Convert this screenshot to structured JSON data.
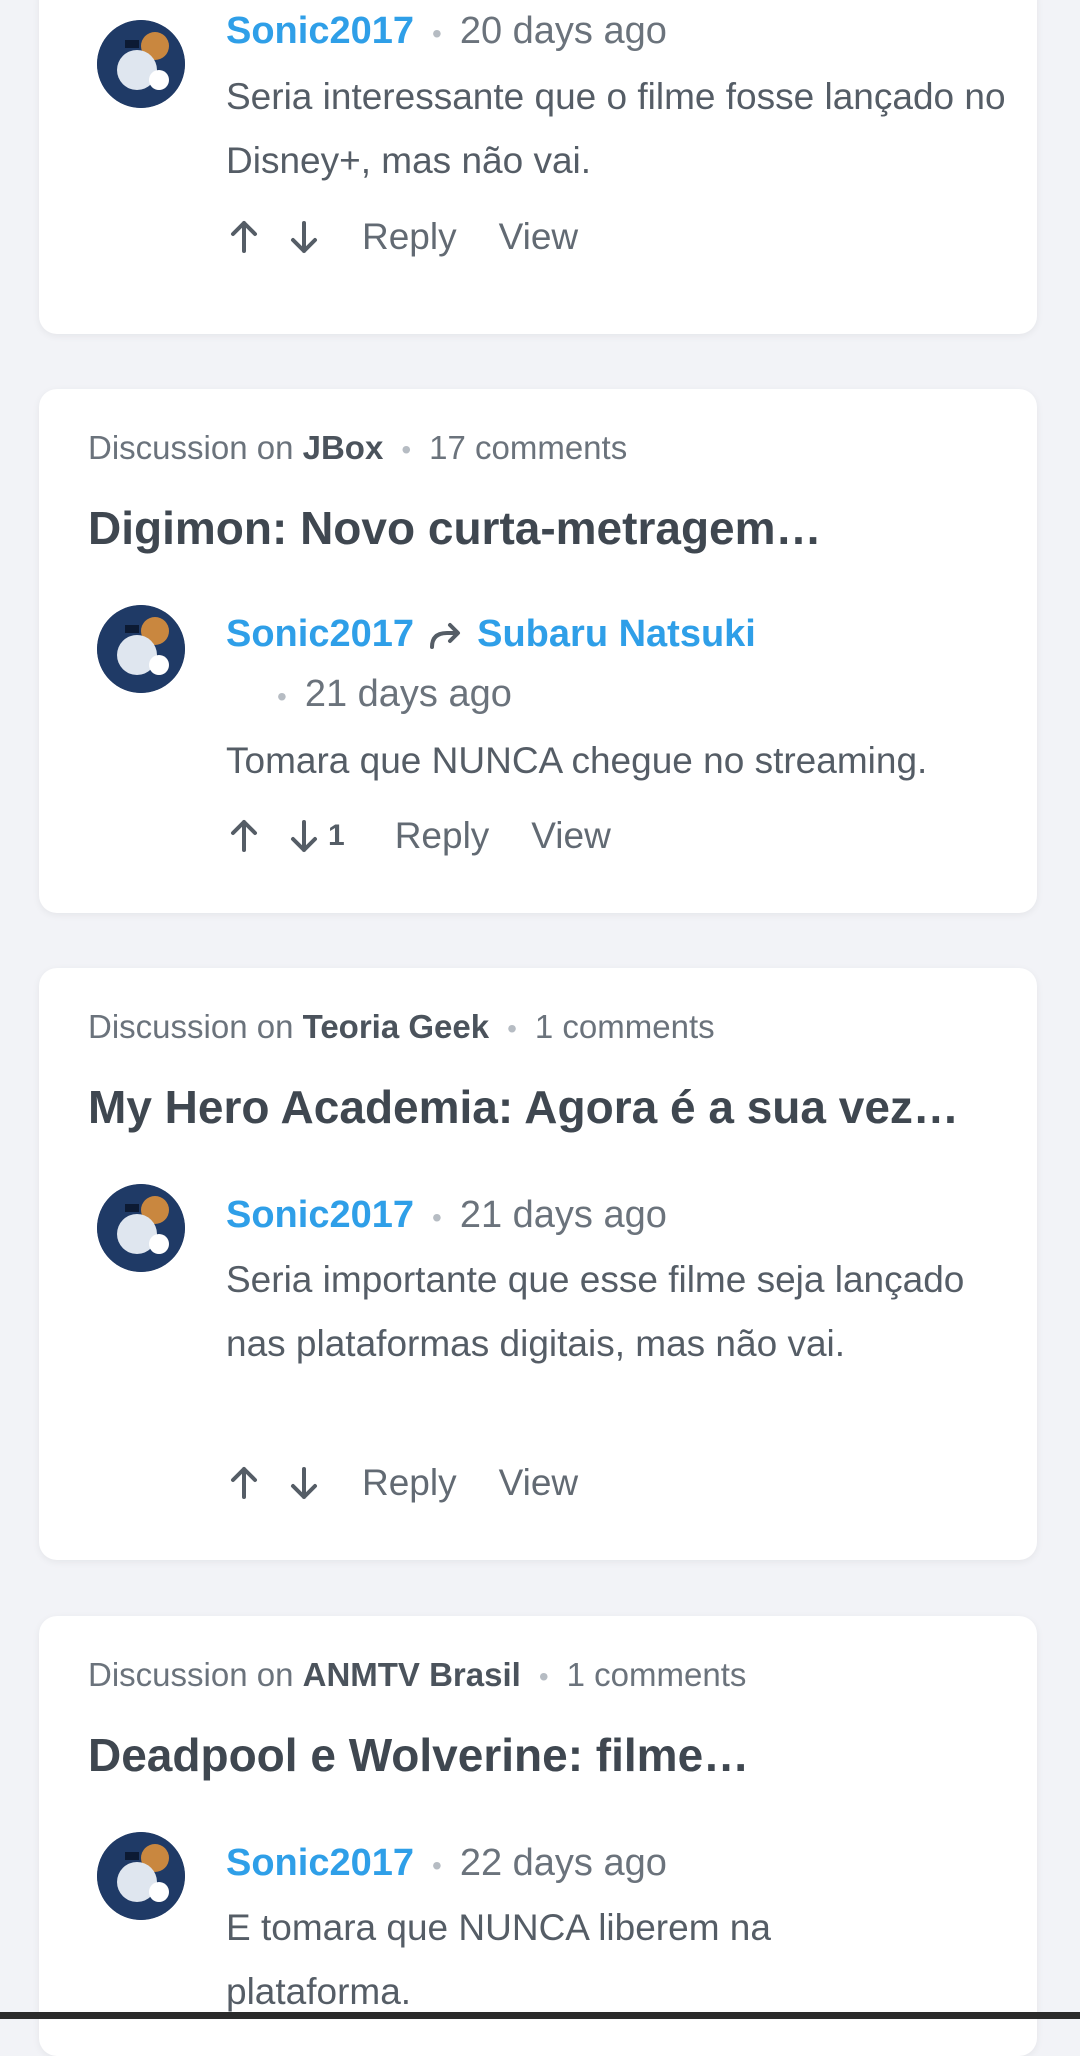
{
  "cards": [
    {
      "comment": {
        "author": "Sonic2017",
        "time": "20 days ago",
        "text": "Seria interessante que o filme fosse lançado no Disney+, mas não vai."
      },
      "actions": {
        "reply": "Reply",
        "view": "View"
      }
    },
    {
      "meta": {
        "prefix": "Discussion on",
        "site": "JBox",
        "comments": "17 comments"
      },
      "title": "Digimon: Novo curta-metragem…",
      "comment": {
        "author": "Sonic2017",
        "reply_to": "Subaru Natsuki",
        "time": "21 days ago",
        "text": "Tomara que NUNCA chegue no streaming.",
        "downvotes": "1"
      },
      "actions": {
        "reply": "Reply",
        "view": "View"
      }
    },
    {
      "meta": {
        "prefix": "Discussion on",
        "site": "Teoria Geek",
        "comments": "1 comments"
      },
      "title": "My Hero Academia: Agora é a sua vez…",
      "comment": {
        "author": "Sonic2017",
        "time": "21 days ago",
        "text": "Seria importante que esse filme seja lançado nas plataformas digitais, mas não vai."
      },
      "actions": {
        "reply": "Reply",
        "view": "View"
      }
    },
    {
      "meta": {
        "prefix": "Discussion on",
        "site": "ANMTV Brasil",
        "comments": "1 comments"
      },
      "title": "Deadpool e Wolverine: filme…",
      "comment": {
        "author": "Sonic2017",
        "time": "22 days ago",
        "text": "E tomara que NUNCA liberem na plataforma."
      }
    }
  ],
  "colors": {
    "author": "#2f9fe8",
    "background": "#f2f3f7",
    "card": "#ffffff"
  }
}
